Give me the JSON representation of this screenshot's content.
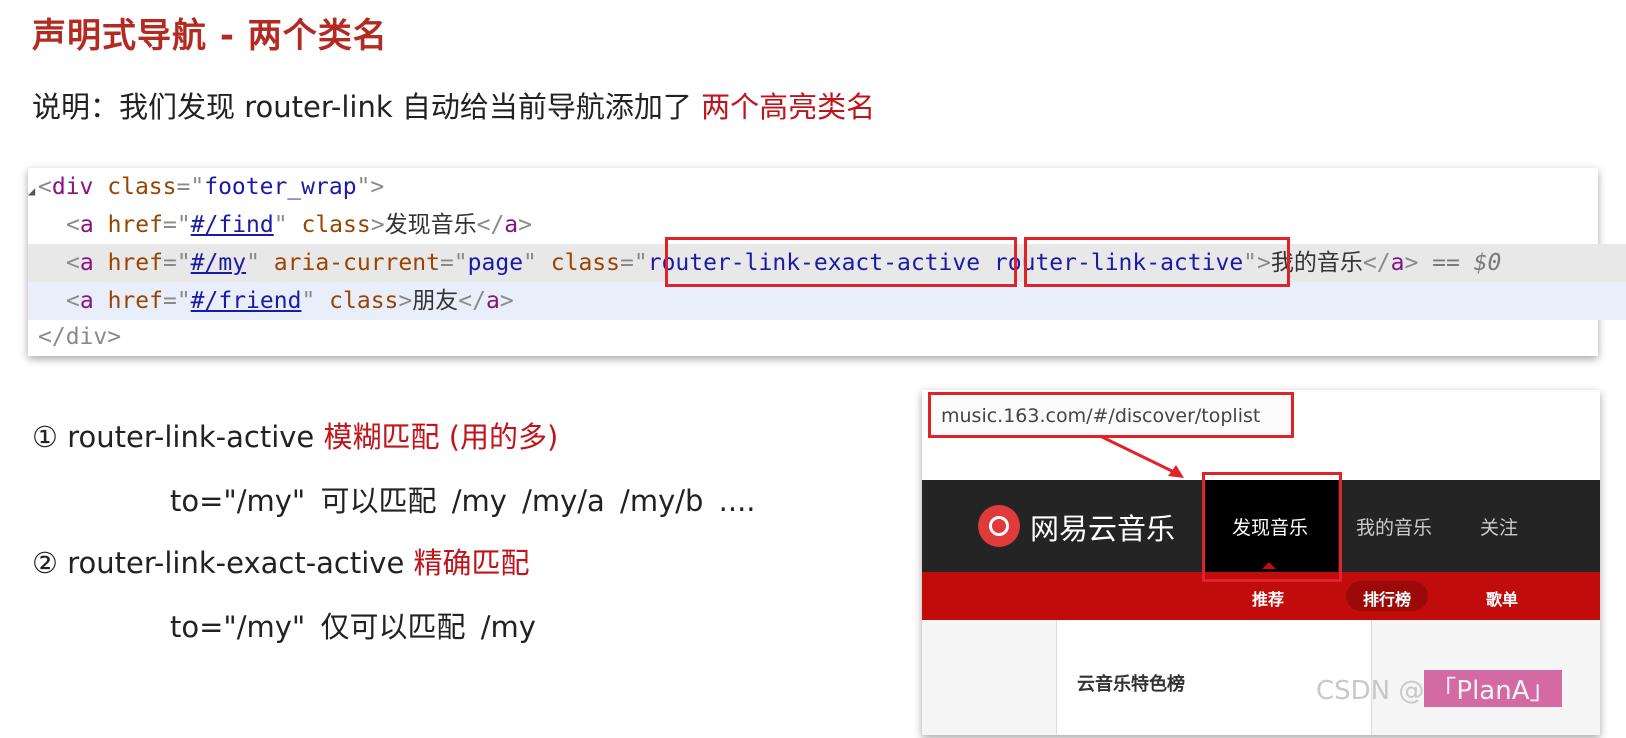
{
  "title": "声明式导航 - 两个类名",
  "description": {
    "prefix": "说明：我们发现 router-link 自动给当前导航添加了 ",
    "highlight": "两个高亮类名"
  },
  "code": {
    "line1": {
      "open": "<",
      "tag": "div",
      "attr": "class",
      "eq": "=\"",
      "val": "footer_wrap",
      "close": "\">"
    },
    "line2": {
      "tag": "a",
      "attr": "href",
      "href": "#/find",
      "attr2": "class",
      "text": "发现音乐"
    },
    "line3": {
      "tag": "a",
      "attr": "href",
      "href": "#/my",
      "attr_aria": "aria-current",
      "aria_val": "page",
      "attr2": "class",
      "class1": "router-link-exact-active",
      "class2": "router-link-active",
      "text": "我的音乐",
      "console": "== $0"
    },
    "line4": {
      "tag": "a",
      "attr": "href",
      "href": "#/friend",
      "attr2": "class",
      "text": "朋友"
    },
    "line5": {
      "close": "</div>"
    }
  },
  "items": [
    {
      "label": "① router-link-active",
      "tag": "模糊匹配 (用的多)",
      "example": "to=\"/my\"  可以匹配   /my     /my/a     /my/b    ...."
    },
    {
      "label": "② router-link-exact-active",
      "tag": "精确匹配",
      "example": "to=\"/my\"  仅可以匹配   /my"
    }
  ],
  "screenshot": {
    "url": "music.163.com/#/discover/toplist",
    "logo": "网易云音乐",
    "nav": [
      "发现音乐",
      "我的音乐",
      "关注"
    ],
    "subnav": [
      "推荐",
      "排行榜",
      "歌单"
    ],
    "content_title": "云音乐特色榜",
    "colors": {
      "nav_bg": "#242424",
      "subnav_bg": "#c20c0c",
      "highlight": "#e0222b"
    }
  },
  "watermark": {
    "text": "CSDN @",
    "name": "「PlanA」"
  }
}
